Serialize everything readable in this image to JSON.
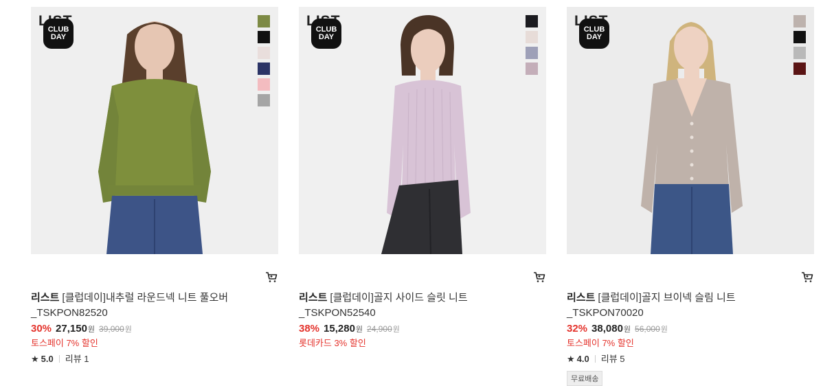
{
  "products": [
    {
      "brand_mark": "LIST",
      "event_badge": [
        "CLUB",
        "DAY"
      ],
      "swatches": [
        "#7d8a44",
        "#111111",
        "#e9dedc",
        "#2b3466",
        "#f3bcc0",
        "#a5a5a5"
      ],
      "image": {
        "bg": "#efefef",
        "top": "#7e8f3c",
        "bottom": "#3d5487",
        "hair": "#5a3f2c",
        "skin": "#e6c6b3"
      },
      "brand": "리스트",
      "name": "[클럽데이]내추럴 라운드넥 니트 풀오버 _TSKPON82520",
      "discount": "30%",
      "price": "27,150",
      "currency": "원",
      "original_price": "39,000",
      "promo": "토스페이 7% 할인",
      "star": "★",
      "rating": "5.0",
      "review_label": "리뷰 1"
    },
    {
      "brand_mark": "LIST",
      "event_badge": [
        "CLUB",
        "DAY"
      ],
      "swatches": [
        "#1b1b20",
        "#e7dcd8",
        "#9ea0b8",
        "#c4aeb9"
      ],
      "image": {
        "bg": "#f0f0f0",
        "top": "#d8c3d6",
        "bottom": "#2f2f33",
        "hair": "#4a3426",
        "skin": "#ebcdbd"
      },
      "brand": "리스트",
      "name": "[클럽데이]골지 사이드 슬릿 니트 _TSKPON52540",
      "discount": "38%",
      "price": "15,280",
      "currency": "원",
      "original_price": "24,900",
      "promo": "롯데카드 3% 할인"
    },
    {
      "brand_mark": "LIST",
      "event_badge": [
        "CLUB",
        "DAY"
      ],
      "swatches": [
        "#bdb2ad",
        "#111111",
        "#b9b9b9",
        "#5a1414"
      ],
      "image": {
        "bg": "#ececec",
        "top": "#bfb2aa",
        "bottom": "#3c5687",
        "hair": "#cfb47d",
        "skin": "#eed2c2"
      },
      "brand": "리스트",
      "name": "[클럽데이]골지 브이넥 슬림 니트 _TSKPON70020",
      "discount": "32%",
      "price": "38,080",
      "currency": "원",
      "original_price": "56,000",
      "promo": "토스페이 7% 할인",
      "star": "★",
      "rating": "4.0",
      "review_label": "리뷰 5",
      "shipping_badge": "무료배송"
    }
  ]
}
